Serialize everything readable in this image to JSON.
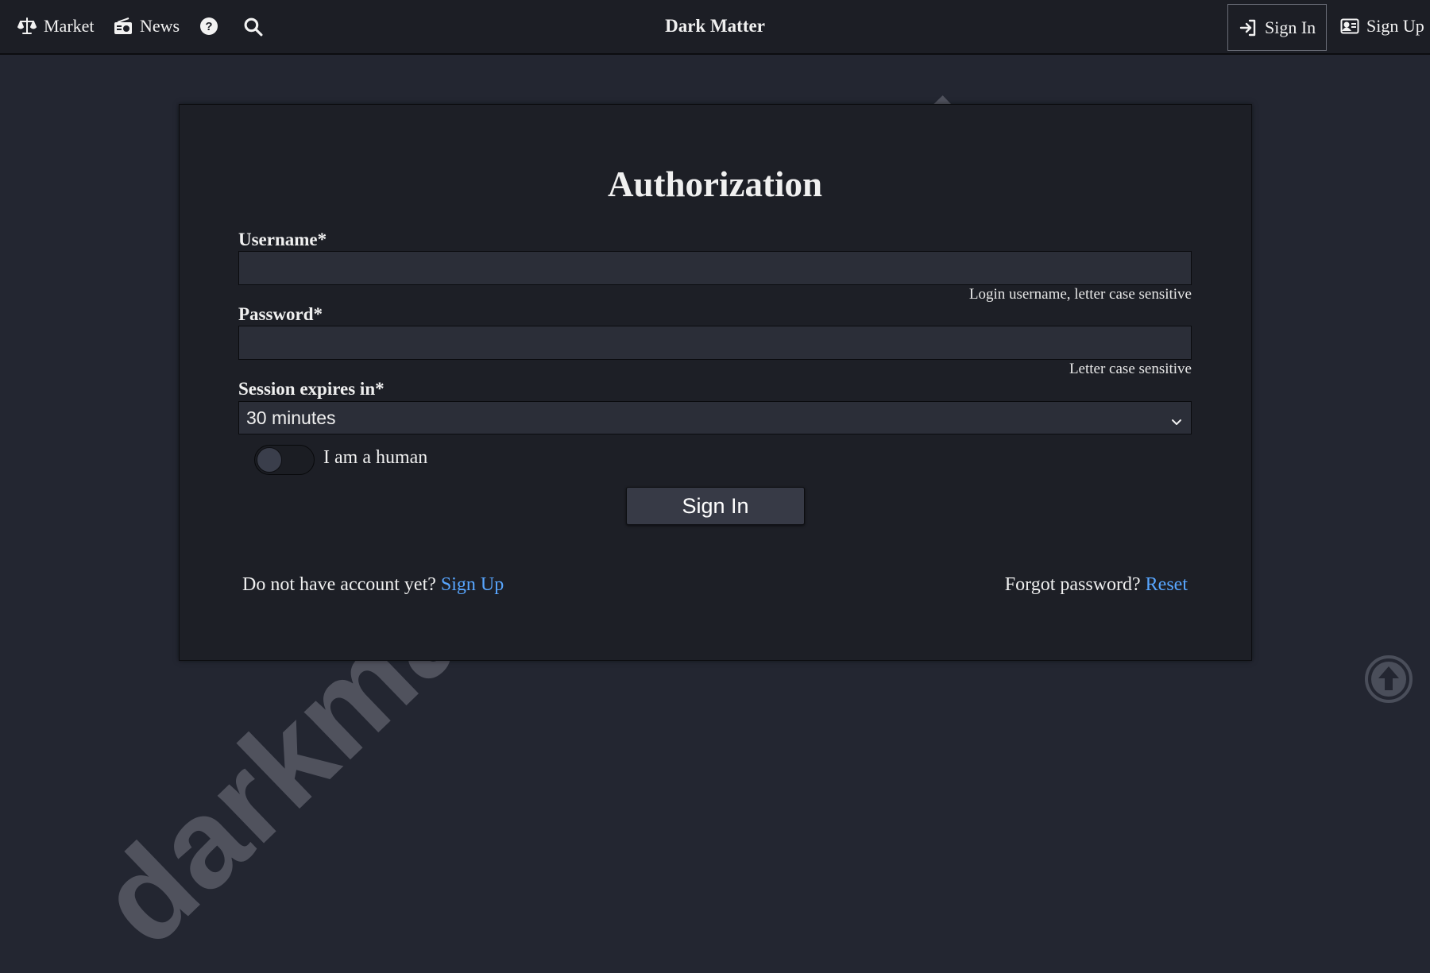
{
  "nav": {
    "market_label": "Market",
    "news_label": "News",
    "brand": "Dark Matter",
    "signin_label": "Sign In",
    "signup_label": "Sign Up"
  },
  "form": {
    "title": "Authorization",
    "username_label": "Username*",
    "username_value": "",
    "username_hint": "Login username, letter case sensitive",
    "password_label": "Password*",
    "password_value": "",
    "password_hint": "Letter case sensitive",
    "session_label": "Session expires in*",
    "session_selected": "30 minutes",
    "human_label": "I am a human",
    "human_checked": false,
    "submit_label": "Sign In"
  },
  "footer": {
    "no_account_text": "Do not have account yet?",
    "signup_link": "Sign Up",
    "forgot_text": "Forgot password?",
    "reset_link": "Reset"
  },
  "watermark": "darkmatter-info.xyz",
  "colors": {
    "background": "#232631",
    "card": "#1d1f26",
    "link": "#58a6ff",
    "nav": "#1c1e25"
  },
  "icons": [
    "balance-scale-icon",
    "radio-icon",
    "question-circle-icon",
    "search-icon",
    "sign-in-icon",
    "id-card-icon",
    "chevron-down-icon",
    "arrow-up-circle-icon"
  ]
}
